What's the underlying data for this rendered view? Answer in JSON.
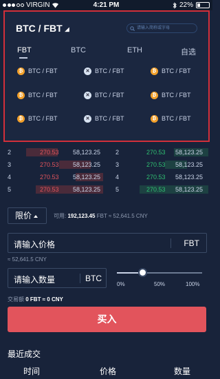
{
  "status_bar": {
    "carrier": "VIRGIN",
    "time": "4:21 PM",
    "battery": "22%"
  },
  "selector": {
    "pair": "BTC / FBT",
    "search_placeholder": "请输入简称或字母",
    "tabs": [
      "FBT",
      "BTC",
      "ETH",
      "自选"
    ],
    "active_tab": "FBT",
    "grid": [
      [
        {
          "icon": "btc",
          "label": "BTC / FBT"
        },
        {
          "icon": "xrp",
          "label": "BTC / FBT"
        },
        {
          "icon": "btc",
          "label": "BTC / FBT"
        }
      ],
      [
        {
          "icon": "btc",
          "label": "BTC / FBT"
        },
        {
          "icon": "xrp",
          "label": "BTC / FBT"
        },
        {
          "icon": "btc",
          "label": "BTC / FBT"
        }
      ],
      [
        {
          "icon": "btc",
          "label": "BTC / FBT"
        },
        {
          "icon": "xrp",
          "label": "BTC / FBT"
        },
        {
          "icon": "btc",
          "label": "BTC / FBT"
        }
      ]
    ]
  },
  "order_book": {
    "bids": [
      {
        "idx": "2",
        "price": "270.53",
        "qty": "58,123.25"
      },
      {
        "idx": "3",
        "price": "270.53",
        "qty": "58,123.25"
      },
      {
        "idx": "4",
        "price": "270.53",
        "qty": "58,123.25"
      },
      {
        "idx": "5",
        "price": "270.53",
        "qty": "58,123.25"
      }
    ],
    "asks": [
      {
        "idx": "2",
        "price": "270.53",
        "qty": "58,123.25"
      },
      {
        "idx": "3",
        "price": "270.53",
        "qty": "58,123.25"
      },
      {
        "idx": "4",
        "price": "270.53",
        "qty": "58,123.25"
      },
      {
        "idx": "5",
        "price": "270.53",
        "qty": "58,123.25"
      }
    ]
  },
  "form": {
    "order_type": "限价",
    "available_label": "可用:",
    "available_value": "192,123.45",
    "available_rest": "FBT ≈ 52,641.5 CNY",
    "price_placeholder": "请输入价格",
    "price_unit": "FBT",
    "price_cny": "≈ 52,641.5 CNY",
    "amount_placeholder": "请输入数量",
    "amount_unit": "BTC",
    "slider_labels": [
      "0%",
      "50%",
      "100%"
    ],
    "slider_value": 0.3,
    "volume_label": "交易额",
    "volume_value": "0 FBT ≈ 0 CNY",
    "buy_label": "买入"
  },
  "recent": {
    "title": "最近成交",
    "columns": [
      "时间",
      "价格",
      "数量"
    ]
  },
  "colors": {
    "bg": "#18233a",
    "sell_red": "#e2545c",
    "buy_green": "#2fbf71",
    "highlight_border": "#d32f3a"
  }
}
